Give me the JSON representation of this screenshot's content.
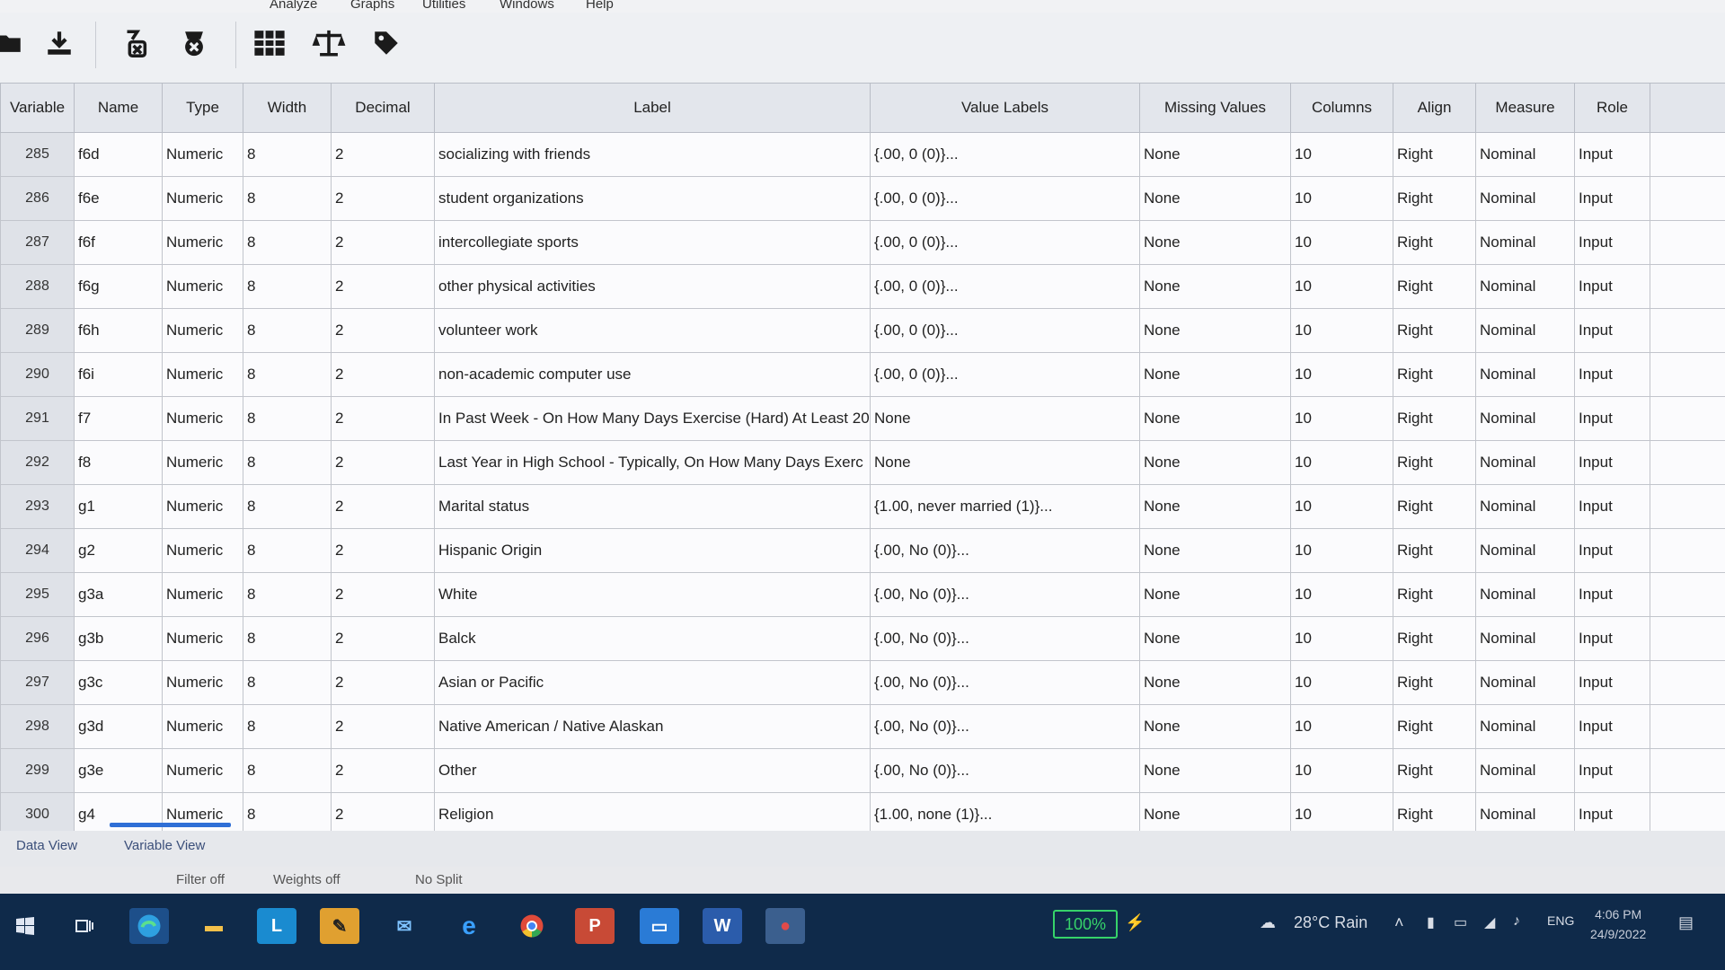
{
  "menu": [
    "Analyze",
    "Graphs",
    "Utilities",
    "Windows",
    "Help"
  ],
  "columns": [
    "Variable",
    "Name",
    "Type",
    "Width",
    "Decimal",
    "Label",
    "Value Labels",
    "Missing Values",
    "Columns",
    "Align",
    "Measure",
    "Role"
  ],
  "rows": [
    {
      "num": "285",
      "name": "f6d",
      "type": "Numeric",
      "width": "8",
      "decimal": "2",
      "label": "socializing with friends",
      "value_labels": "{.00, 0     (0)}...",
      "missing": "None",
      "columns": "10",
      "align": "Right",
      "measure": "Nominal",
      "role": "Input"
    },
    {
      "num": "286",
      "name": "f6e",
      "type": "Numeric",
      "width": "8",
      "decimal": "2",
      "label": "student organizations",
      "value_labels": "{.00, 0     (0)}...",
      "missing": "None",
      "columns": "10",
      "align": "Right",
      "measure": "Nominal",
      "role": "Input"
    },
    {
      "num": "287",
      "name": "f6f",
      "type": "Numeric",
      "width": "8",
      "decimal": "2",
      "label": "intercollegiate sports",
      "value_labels": "{.00, 0     (0)}...",
      "missing": "None",
      "columns": "10",
      "align": "Right",
      "measure": "Nominal",
      "role": "Input"
    },
    {
      "num": "288",
      "name": "f6g",
      "type": "Numeric",
      "width": "8",
      "decimal": "2",
      "label": "other physical activities",
      "value_labels": "{.00, 0     (0)}...",
      "missing": "None",
      "columns": "10",
      "align": "Right",
      "measure": "Nominal",
      "role": "Input"
    },
    {
      "num": "289",
      "name": "f6h",
      "type": "Numeric",
      "width": "8",
      "decimal": "2",
      "label": "volunteer work",
      "value_labels": "{.00, 0     (0)}...",
      "missing": "None",
      "columns": "10",
      "align": "Right",
      "measure": "Nominal",
      "role": "Input"
    },
    {
      "num": "290",
      "name": "f6i",
      "type": "Numeric",
      "width": "8",
      "decimal": "2",
      "label": "non-academic computer use",
      "value_labels": "{.00, 0     (0)}...",
      "missing": "None",
      "columns": "10",
      "align": "Right",
      "measure": "Nominal",
      "role": "Input"
    },
    {
      "num": "291",
      "name": "f7",
      "type": "Numeric",
      "width": "8",
      "decimal": "2",
      "label": "In Past Week - On How Many Days Exercise (Hard) At Least 20",
      "value_labels": "None",
      "missing": "None",
      "columns": "10",
      "align": "Right",
      "measure": "Nominal",
      "role": "Input"
    },
    {
      "num": "292",
      "name": "f8",
      "type": "Numeric",
      "width": "8",
      "decimal": "2",
      "label": "Last Year in High School - Typically, On How Many Days Exerc",
      "value_labels": "None",
      "missing": "None",
      "columns": "10",
      "align": "Right",
      "measure": "Nominal",
      "role": "Input"
    },
    {
      "num": "293",
      "name": "g1",
      "type": "Numeric",
      "width": "8",
      "decimal": "2",
      "label": "Marital status",
      "value_labels": "{1.00, never married (1)}...",
      "missing": "None",
      "columns": "10",
      "align": "Right",
      "measure": "Nominal",
      "role": "Input"
    },
    {
      "num": "294",
      "name": "g2",
      "type": "Numeric",
      "width": "8",
      "decimal": "2",
      "label": "Hispanic Origin",
      "value_labels": "{.00, No     (0)}...",
      "missing": "None",
      "columns": "10",
      "align": "Right",
      "measure": "Nominal",
      "role": "Input"
    },
    {
      "num": "295",
      "name": "g3a",
      "type": "Numeric",
      "width": "8",
      "decimal": "2",
      "label": "White",
      "value_labels": "{.00, No     (0)}...",
      "missing": "None",
      "columns": "10",
      "align": "Right",
      "measure": "Nominal",
      "role": "Input"
    },
    {
      "num": "296",
      "name": "g3b",
      "type": "Numeric",
      "width": "8",
      "decimal": "2",
      "label": "Balck",
      "value_labels": "{.00, No     (0)}...",
      "missing": "None",
      "columns": "10",
      "align": "Right",
      "measure": "Nominal",
      "role": "Input"
    },
    {
      "num": "297",
      "name": "g3c",
      "type": "Numeric",
      "width": "8",
      "decimal": "2",
      "label": "Asian or Pacific",
      "value_labels": "{.00, No     (0)}...",
      "missing": "None",
      "columns": "10",
      "align": "Right",
      "measure": "Nominal",
      "role": "Input"
    },
    {
      "num": "298",
      "name": "g3d",
      "type": "Numeric",
      "width": "8",
      "decimal": "2",
      "label": "Native American / Native Alaskan",
      "value_labels": "{.00, No     (0)}...",
      "missing": "None",
      "columns": "10",
      "align": "Right",
      "measure": "Nominal",
      "role": "Input"
    },
    {
      "num": "299",
      "name": "g3e",
      "type": "Numeric",
      "width": "8",
      "decimal": "2",
      "label": "Other",
      "value_labels": "{.00, No     (0)}...",
      "missing": "None",
      "columns": "10",
      "align": "Right",
      "measure": "Nominal",
      "role": "Input"
    },
    {
      "num": "300",
      "name": "g4",
      "type": "Numeric",
      "width": "8",
      "decimal": "2",
      "label": "Religion",
      "value_labels": "{1.00, none       (1)}...",
      "missing": "None",
      "columns": "10",
      "align": "Right",
      "measure": "Nominal",
      "role": "Input"
    }
  ],
  "tabs": {
    "data_view": "Data View",
    "variable_view": "Variable View",
    "active": "variable_view"
  },
  "status": {
    "filter": "Filter off",
    "weights": "Weights off",
    "split": "No Split"
  },
  "taskbar": {
    "battery": "100%",
    "weather": "28°C  Rain",
    "lang": "ENG",
    "time": "4:06 PM",
    "date": "24/9/2022",
    "accent": "#36d36a"
  },
  "icons": [
    "open-icon",
    "save-icon",
    "delete-variable-icon",
    "cancel-icon",
    "data-grid-icon",
    "weight-scale-icon",
    "value-label-tag-icon"
  ]
}
